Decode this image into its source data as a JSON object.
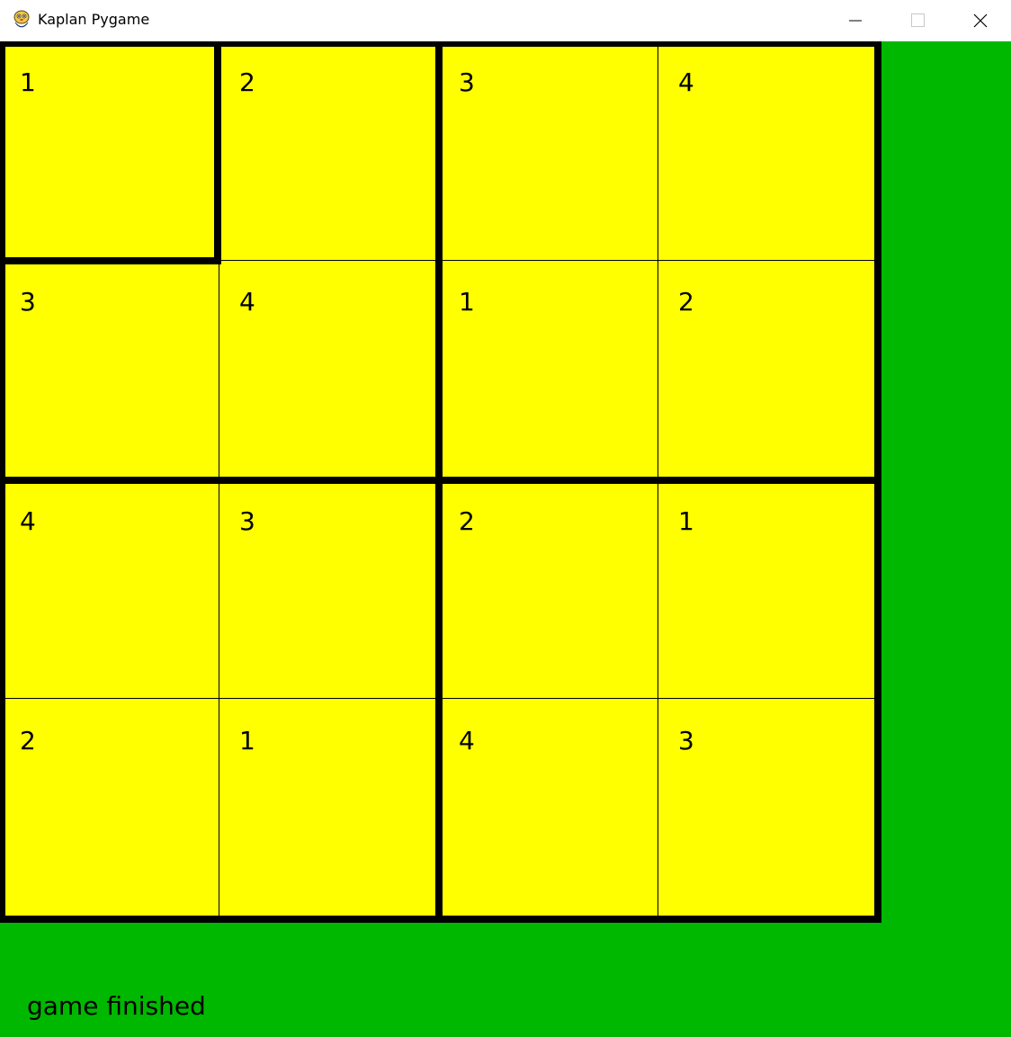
{
  "window": {
    "title": "Kaplan Pygame",
    "app_icon": "python-snake-icon",
    "controls": {
      "minimize_icon": "minimize-icon",
      "maximize_icon": "maximize-icon",
      "close_icon": "close-icon"
    }
  },
  "colors": {
    "background": "#00b800",
    "board": "#ffff00",
    "lines": "#000000"
  },
  "board": {
    "size": 4,
    "rows": [
      [
        "1",
        "2",
        "3",
        "4"
      ],
      [
        "3",
        "4",
        "1",
        "2"
      ],
      [
        "4",
        "3",
        "2",
        "1"
      ],
      [
        "2",
        "1",
        "4",
        "3"
      ]
    ],
    "selected_cell": {
      "row": 1,
      "col": 1
    }
  },
  "status": "game finished"
}
